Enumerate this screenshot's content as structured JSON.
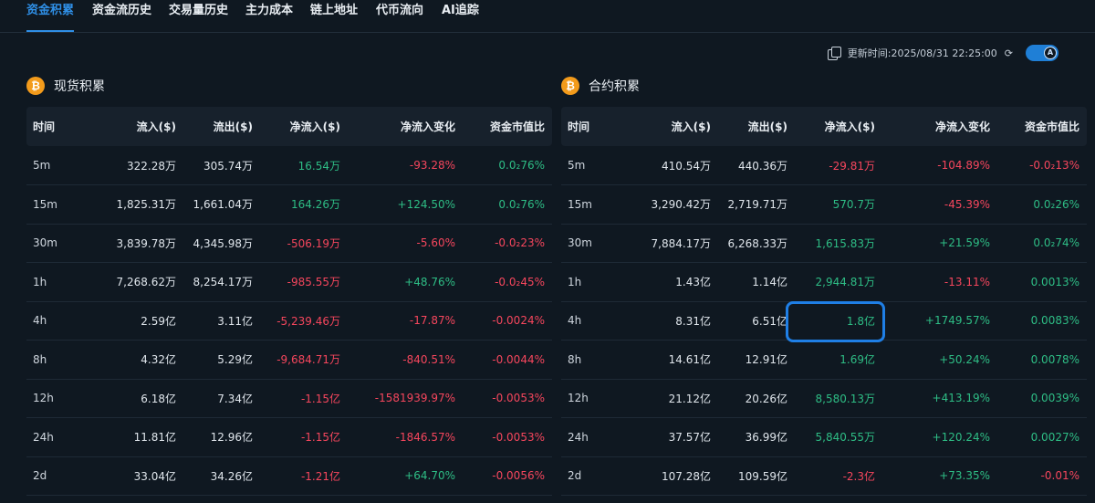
{
  "tabs": [
    "资金积累",
    "资金流历史",
    "交易量历史",
    "主力成本",
    "链上地址",
    "代币流向",
    "AI追踪"
  ],
  "update_time": "更新时间:2025/08/31 22:25:00",
  "icons": {
    "copy": "copy-icon",
    "refresh": "refresh-icon",
    "toggle": "ai-toggle",
    "section": "bitcoin-icon"
  },
  "colors": {
    "accent": "#2f8fe6",
    "positive": "#2ebd85",
    "negative": "#f6465d",
    "bitcoin": "#f39b1b"
  },
  "spot": {
    "title": "现货积累",
    "columns": [
      "时间",
      "流入($)",
      "流出($)",
      "净流入($)",
      "净流入变化",
      "资金市值比"
    ],
    "rows": [
      [
        "5m",
        "322.28万",
        "305.74万",
        "16.54万",
        "-93.28%",
        "0.0₂76%"
      ],
      [
        "15m",
        "1,825.31万",
        "1,661.04万",
        "164.26万",
        "+124.50%",
        "0.0₂76%"
      ],
      [
        "30m",
        "3,839.78万",
        "4,345.98万",
        "-506.19万",
        "-5.60%",
        "-0.0₂23%"
      ],
      [
        "1h",
        "7,268.62万",
        "8,254.17万",
        "-985.55万",
        "+48.76%",
        "-0.0₂45%"
      ],
      [
        "4h",
        "2.59亿",
        "3.11亿",
        "-5,239.46万",
        "-17.87%",
        "-0.0024%"
      ],
      [
        "8h",
        "4.32亿",
        "5.29亿",
        "-9,684.71万",
        "-840.51%",
        "-0.0044%"
      ],
      [
        "12h",
        "6.18亿",
        "7.34亿",
        "-1.15亿",
        "-1581939.97%",
        "-0.0053%"
      ],
      [
        "24h",
        "11.81亿",
        "12.96亿",
        "-1.15亿",
        "-1846.57%",
        "-0.0053%"
      ],
      [
        "2d",
        "33.04亿",
        "34.26亿",
        "-1.21亿",
        "+64.70%",
        "-0.0056%"
      ]
    ]
  },
  "futures": {
    "title": "合约积累",
    "columns": [
      "时间",
      "流入($)",
      "流出($)",
      "净流入($)",
      "净流入变化",
      "资金市值比"
    ],
    "rows": [
      [
        "5m",
        "410.54万",
        "440.36万",
        "-29.81万",
        "-104.89%",
        "-0.0₂13%"
      ],
      [
        "15m",
        "3,290.42万",
        "2,719.71万",
        "570.7万",
        "-45.39%",
        "0.0₂26%"
      ],
      [
        "30m",
        "7,884.17万",
        "6,268.33万",
        "1,615.83万",
        "+21.59%",
        "0.0₂74%"
      ],
      [
        "1h",
        "1.43亿",
        "1.14亿",
        "2,944.81万",
        "-13.11%",
        "0.0013%"
      ],
      [
        "4h",
        "8.31亿",
        "6.51亿",
        "1.8亿",
        "+1749.57%",
        "0.0083%"
      ],
      [
        "8h",
        "14.61亿",
        "12.91亿",
        "1.69亿",
        "+50.24%",
        "0.0078%"
      ],
      [
        "12h",
        "21.12亿",
        "20.26亿",
        "8,580.13万",
        "+413.19%",
        "0.0039%"
      ],
      [
        "24h",
        "37.57亿",
        "36.99亿",
        "5,840.55万",
        "+120.24%",
        "0.0027%"
      ],
      [
        "2d",
        "107.28亿",
        "109.59亿",
        "-2.3亿",
        "+73.35%",
        "-0.01%"
      ]
    ]
  }
}
